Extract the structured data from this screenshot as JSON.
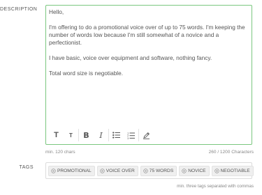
{
  "description": {
    "label": "DESCRIPTION",
    "paragraphs": [
      "Hello,",
      "I'm offering to do a promotional voice over of up to 75 words. I'm keeping the number of words low because I'm still somewhat of a novice and a perfectionist.",
      "I have basic, voice over equipment and software, nothing fancy.",
      "Total word size is negotiable."
    ],
    "min_hint": "min. 120 chars",
    "char_count": "260 / 1200 Characters"
  },
  "toolbar": {
    "heading_large": "T",
    "heading_small": "T",
    "bold": "B",
    "italic": "I",
    "icons": [
      "heading-large-icon",
      "heading-small-icon",
      "bold-icon",
      "italic-icon",
      "bullet-list-icon",
      "numbered-list-icon",
      "pen-icon"
    ]
  },
  "tags": {
    "label": "TAGS",
    "items": [
      "PROMOTIONAL",
      "VOICE OVER",
      "75 WORDS",
      "NOVICE",
      "NEGOTIABLE"
    ],
    "hint": "min. three tags separated with commas"
  },
  "colors": {
    "editor_border_focus": "#7ac77f",
    "text": "#555555",
    "tag_bg": "#efefef"
  }
}
